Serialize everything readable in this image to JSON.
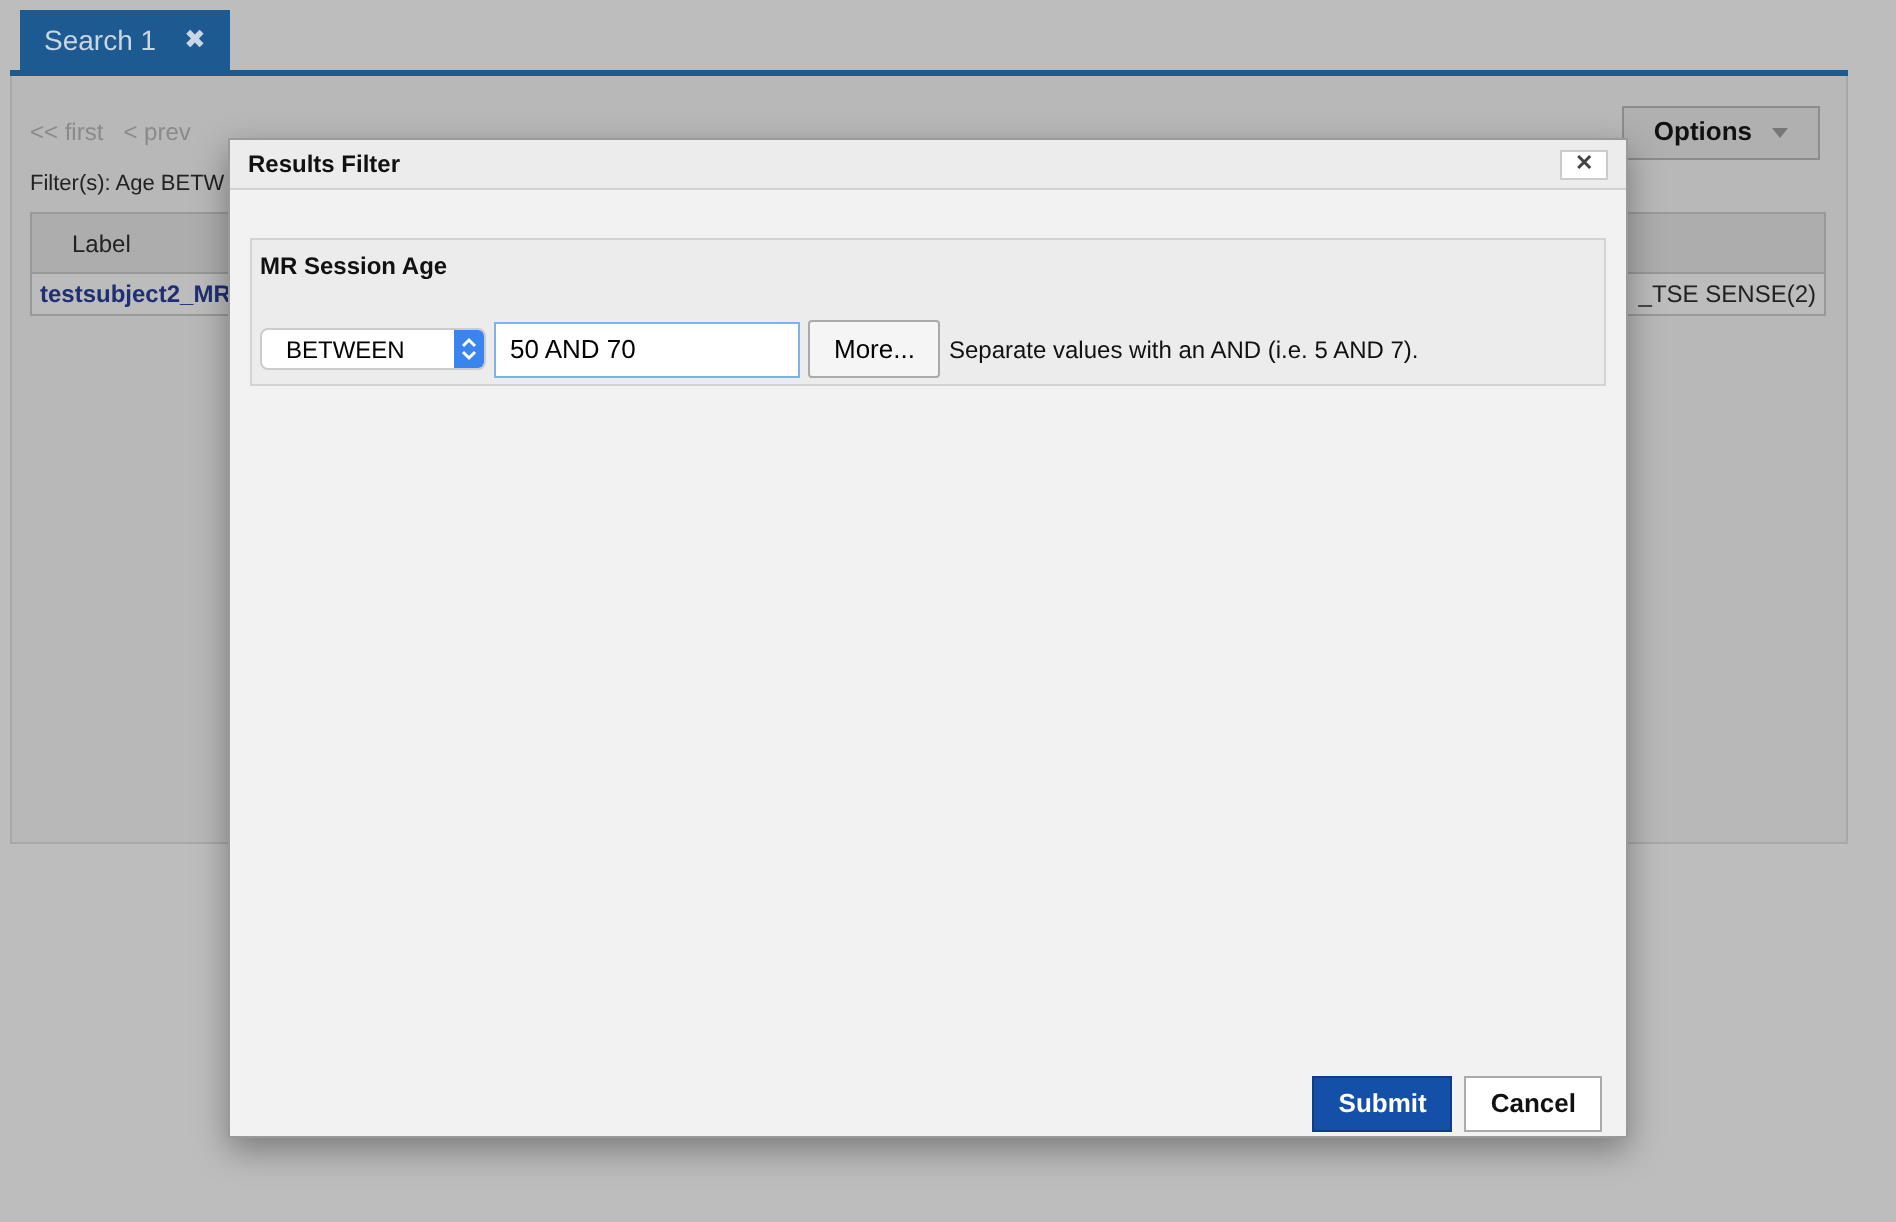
{
  "tab": {
    "label": "Search 1",
    "close": "✖"
  },
  "pager": {
    "first": "<< first",
    "prev": "< prev"
  },
  "options_button": "Options",
  "filter_summary": "Filter(s): Age BETW",
  "table": {
    "columns": [
      "Label"
    ],
    "rows": [
      {
        "label": "testsubject2_MR",
        "column_end": "_TSE SENSE(2)"
      }
    ]
  },
  "dialog": {
    "title": "Results Filter",
    "close": "✕",
    "field": {
      "label": "MR Session Age",
      "operator": "BETWEEN",
      "value": "50 AND 70",
      "more": "More...",
      "hint": "Separate values with an AND (i.e. 5 AND 7)."
    },
    "buttons": [
      {
        "label": "Submit",
        "kind": "primary"
      },
      {
        "label": "Cancel",
        "kind": "secondary"
      }
    ]
  }
}
